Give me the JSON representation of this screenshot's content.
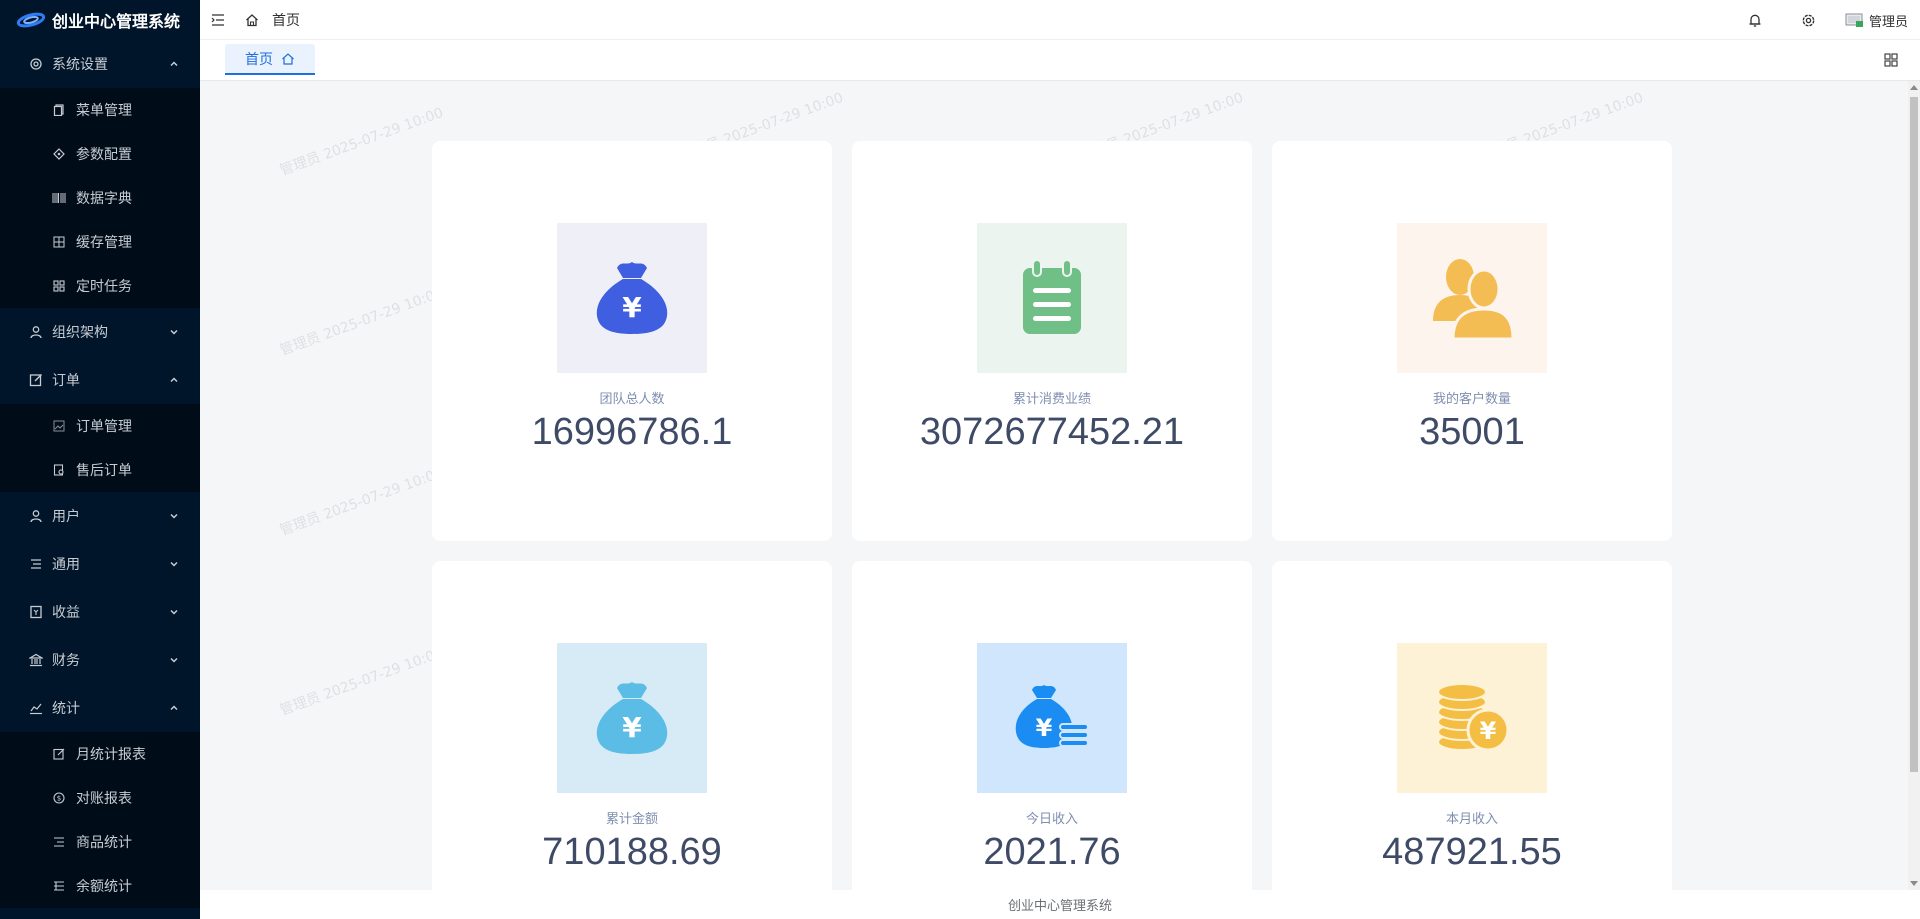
{
  "app": {
    "title": "创业中心管理系统"
  },
  "sidebar": {
    "system": {
      "label": "系统设置",
      "items": [
        "菜单管理",
        "参数配置",
        "数据字典",
        "缓存管理",
        "定时任务"
      ]
    },
    "org": {
      "label": "组织架构"
    },
    "order": {
      "label": "订单",
      "items": [
        "订单管理",
        "售后订单"
      ]
    },
    "user": {
      "label": "用户"
    },
    "general": {
      "label": "通用"
    },
    "income": {
      "label": "收益"
    },
    "finance": {
      "label": "财务"
    },
    "stats": {
      "label": "统计",
      "items": [
        "月统计报表",
        "对账报表",
        "商品统计",
        "余额统计"
      ]
    }
  },
  "header": {
    "breadcrumb": "首页",
    "user_name": "管理员"
  },
  "tabs": [
    {
      "label": "首页"
    }
  ],
  "watermark": {
    "text": "管理员 2025-07-29 10:00"
  },
  "cards": [
    {
      "label": "团队总人数",
      "value": "16996786.1",
      "icon": "money-bag-icon",
      "bg": "#eff0f7",
      "color": "#3f5ee0"
    },
    {
      "label": "累计消费业绩",
      "value": "3072677452.21",
      "icon": "notepad-icon",
      "bg": "#ecf4ef",
      "color": "#6fbf86"
    },
    {
      "label": "我的客户数量",
      "value": "35001",
      "icon": "users-icon",
      "bg": "#fdf4ed",
      "color": "#f4bd53"
    },
    {
      "label": "累计金额",
      "value": "710188.69",
      "icon": "money-bag-icon",
      "bg": "#d6ebf6",
      "color": "#5bbce6"
    },
    {
      "label": "今日收入",
      "value": "2021.76",
      "icon": "money-bag-coins-icon",
      "bg": "#d0e6fc",
      "color": "#1b8cf2"
    },
    {
      "label": "本月收入",
      "value": "487921.55",
      "icon": "coin-stack-icon",
      "bg": "#fdf2d6",
      "color": "#f4be45"
    }
  ],
  "footer": {
    "text": "创业中心管理系统"
  },
  "colors": {
    "sidebar_bg": "#001529",
    "submenu_bg": "#000c17",
    "accent": "#1f6fe0"
  }
}
